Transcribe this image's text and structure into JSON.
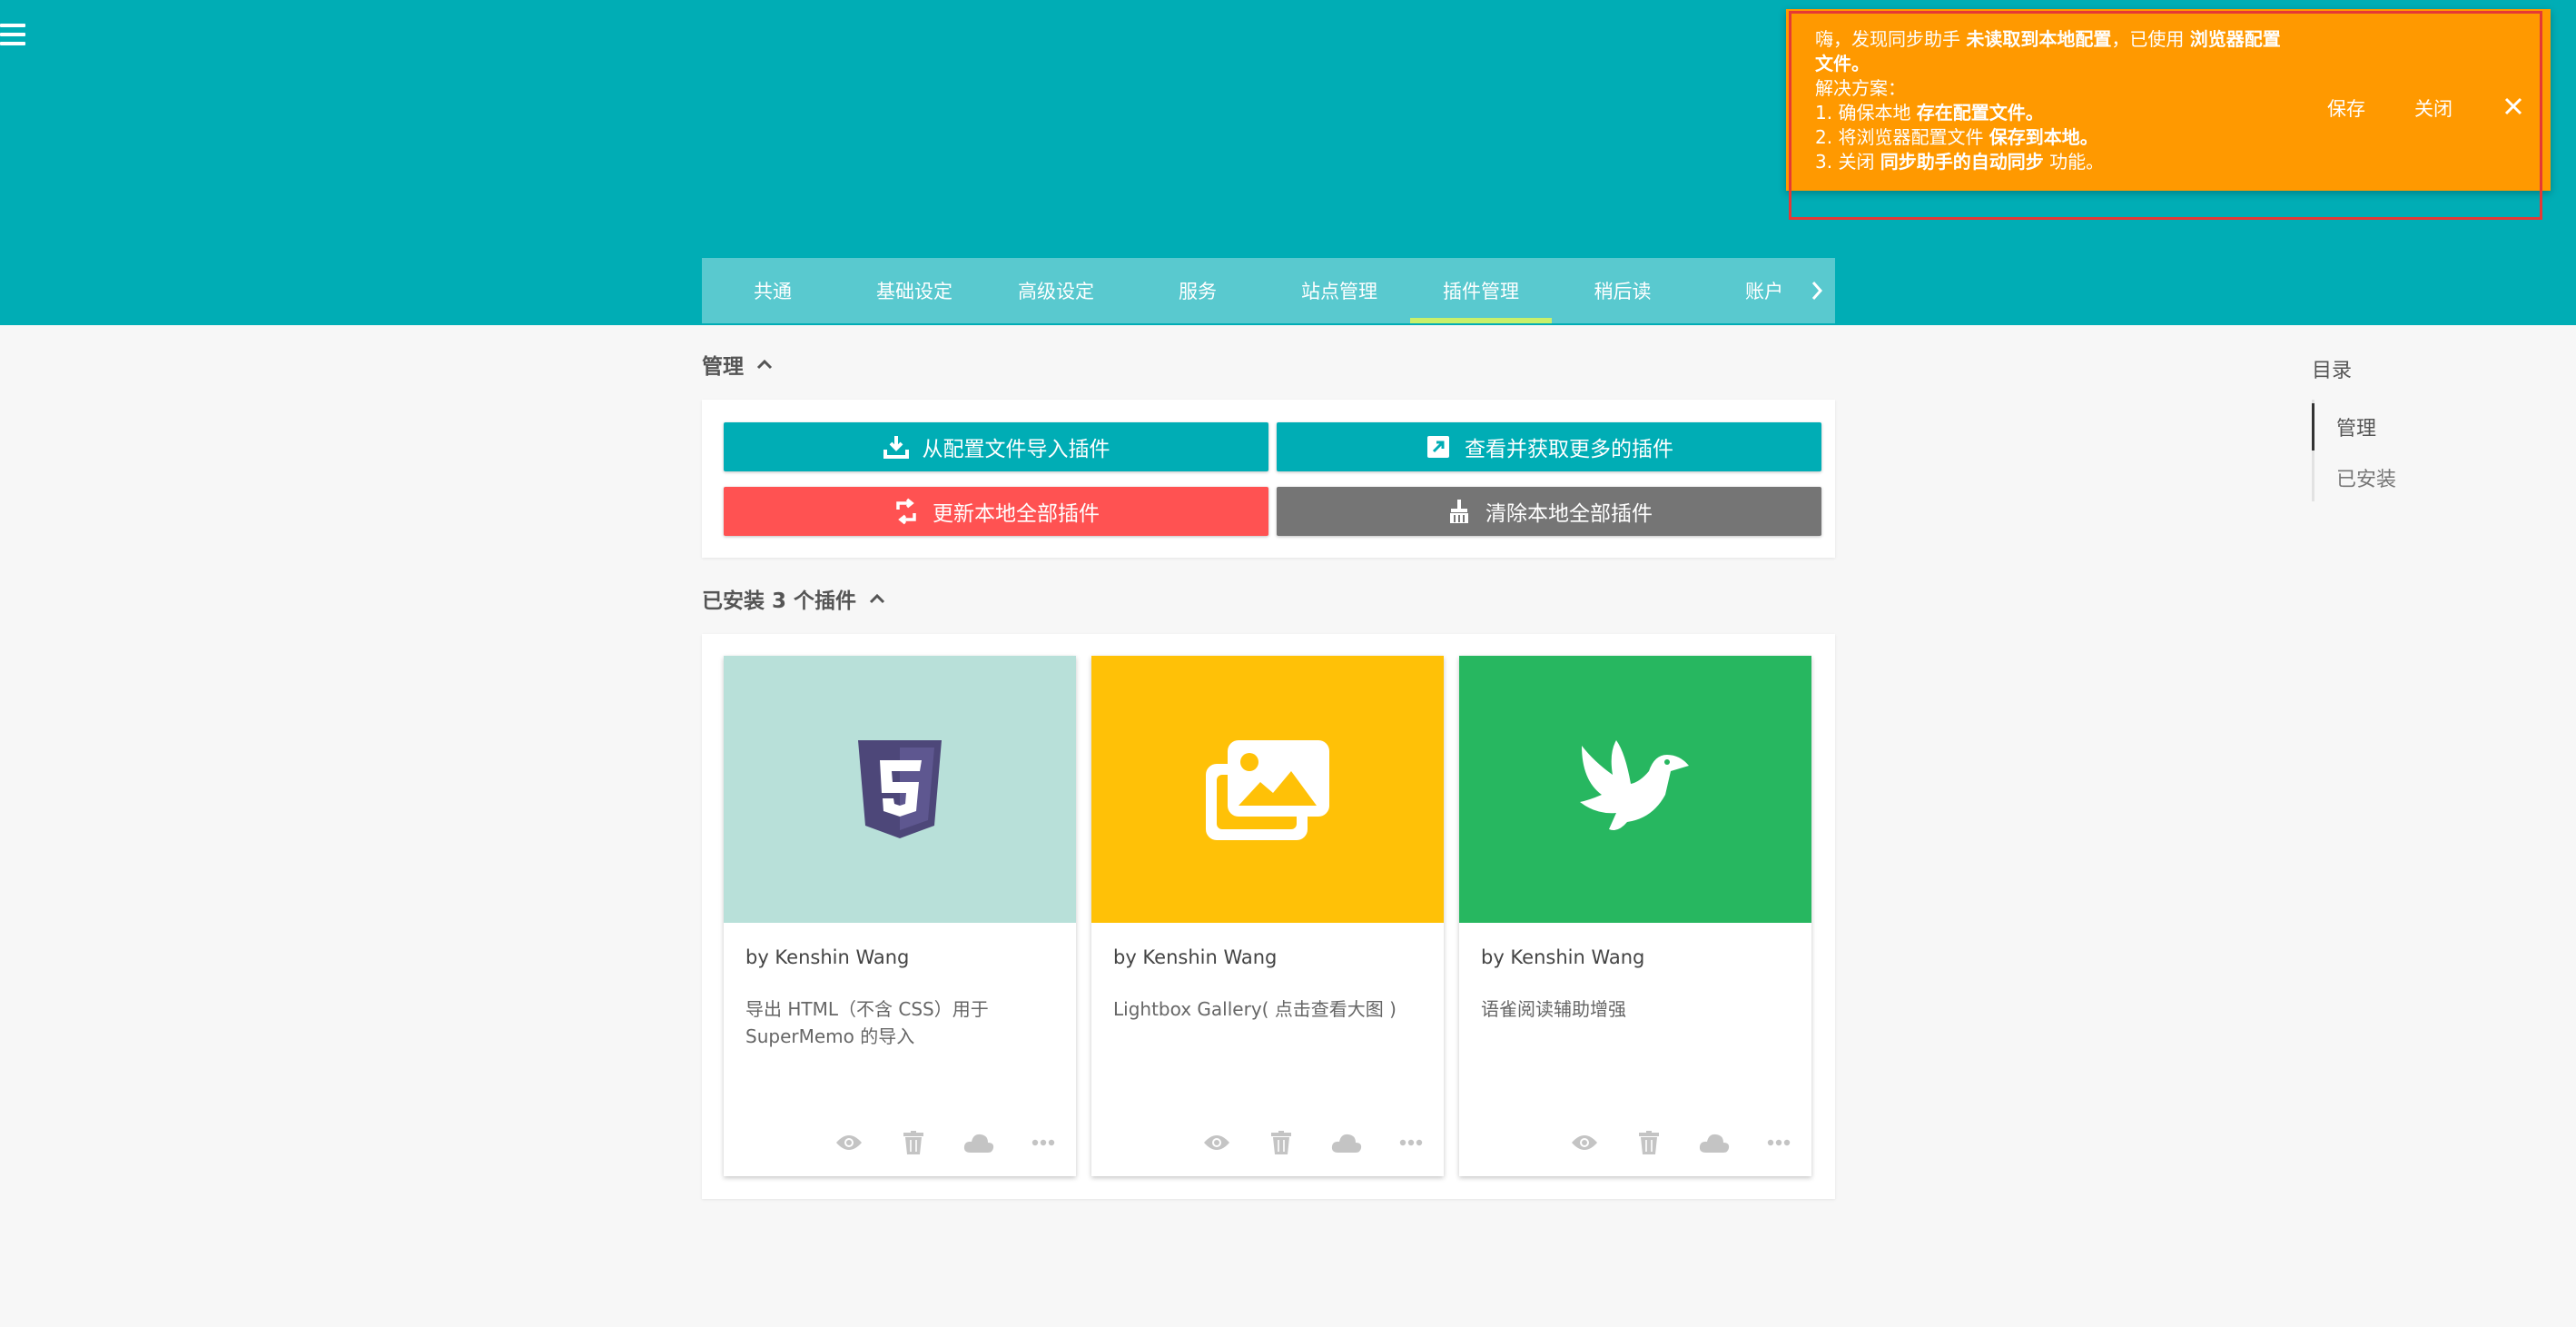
{
  "tabs": [
    {
      "label": "共通"
    },
    {
      "label": "基础设定"
    },
    {
      "label": "高级设定"
    },
    {
      "label": "服务"
    },
    {
      "label": "站点管理"
    },
    {
      "label": "插件管理",
      "active": true
    },
    {
      "label": "稍后读"
    },
    {
      "label": "账户"
    }
  ],
  "toast": {
    "line1_a": "嗨，发现同步助手 ",
    "line1_b": "未读取到本地配置",
    "line1_c": "，已使用 ",
    "line1_d": "浏览器配置文件",
    "line1_e": "。",
    "line2": "解决方案：",
    "line3_a": "1. 确保本地 ",
    "line3_b": "存在配置文件",
    "line3_c": "。",
    "line4_a": "2. 将浏览器配置文件 ",
    "line4_b": "保存到本地",
    "line4_c": "。",
    "line5_a": "3. 关闭 ",
    "line5_b": "同步助手的自动同步",
    "line5_c": " 功能。",
    "save_label": "保存",
    "close_label": "关闭",
    "bg_color": "#ff9900"
  },
  "manage": {
    "title": "管理",
    "import_label": "从配置文件导入插件",
    "browse_label": "查看并获取更多的插件",
    "update_label": "更新本地全部插件",
    "clear_label": "清除本地全部插件",
    "colors": {
      "primary": "#00adb5",
      "danger": "#ff5252",
      "neutral": "#757575"
    }
  },
  "installed": {
    "title": "已安装 3 个插件",
    "plugins": [
      {
        "author": "by Kenshin Wang",
        "desc": "导出 HTML（不含 CSS）用于 SuperMemo 的导入",
        "icon": "html5-icon",
        "color": "#b8e0d9"
      },
      {
        "author": "by Kenshin Wang",
        "desc": "Lightbox Gallery( 点击查看大图 )",
        "icon": "images-icon",
        "color": "#ffc107"
      },
      {
        "author": "by Kenshin Wang",
        "desc": "语雀阅读辅助增强",
        "icon": "dove-icon",
        "color": "#27b760"
      }
    ]
  },
  "toc": {
    "title": "目录",
    "items": [
      "管理",
      "已安装"
    ]
  }
}
